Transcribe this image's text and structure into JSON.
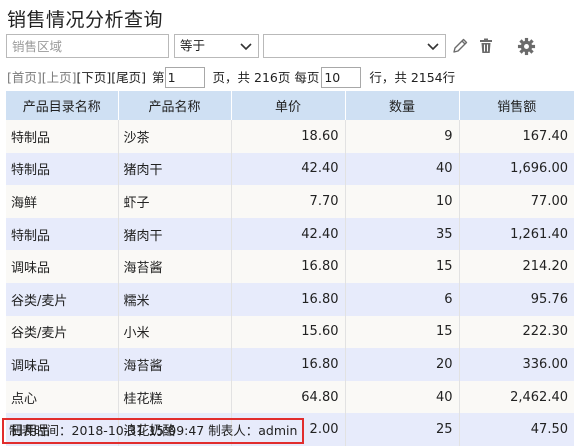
{
  "page": {
    "title": "销售情况分析查询"
  },
  "filter": {
    "field_placeholder": "销售区域",
    "operator": "等于",
    "value": "",
    "icons": [
      "pencil-icon",
      "trash-icon",
      "gear-icon"
    ]
  },
  "pager": {
    "first": "[首页]",
    "prev": "[上页]",
    "next": "[下页]",
    "last": "[尾页]",
    "page_prefix": "第",
    "page_value": "1",
    "page_mid": "页，共 216页 每页",
    "per_page_value": "10",
    "page_suffix": "行，共 2154行"
  },
  "table": {
    "headers": [
      "产品目录名称",
      "产品名称",
      "单价",
      "数量",
      "销售额"
    ],
    "rows": [
      [
        "特制品",
        "沙茶",
        "18.60",
        "9",
        "167.40"
      ],
      [
        "特制品",
        "猪肉干",
        "42.40",
        "40",
        "1,696.00"
      ],
      [
        "海鲜",
        "虾子",
        "7.70",
        "10",
        "77.00"
      ],
      [
        "特制品",
        "猪肉干",
        "42.40",
        "35",
        "1,261.40"
      ],
      [
        "调味品",
        "海苔酱",
        "16.80",
        "15",
        "214.20"
      ],
      [
        "谷类/麦片",
        "糯米",
        "16.80",
        "6",
        "95.76"
      ],
      [
        "谷类/麦片",
        "小米",
        "15.60",
        "15",
        "222.30"
      ],
      [
        "调味品",
        "海苔酱",
        "16.80",
        "20",
        "336.00"
      ],
      [
        "点心",
        "桂花糕",
        "64.80",
        "40",
        "2,462.40"
      ],
      [
        "日用品",
        "浪花奶酪",
        "2.00",
        "25",
        "47.50"
      ]
    ]
  },
  "footer": {
    "text": "制表时间：2018-10-31 15:09:47 制表人：admin"
  },
  "colors": {
    "header_bg": "#cfe0f3",
    "row_alt_bg": "#e7ebfb",
    "footer_border": "#e12d2d"
  }
}
